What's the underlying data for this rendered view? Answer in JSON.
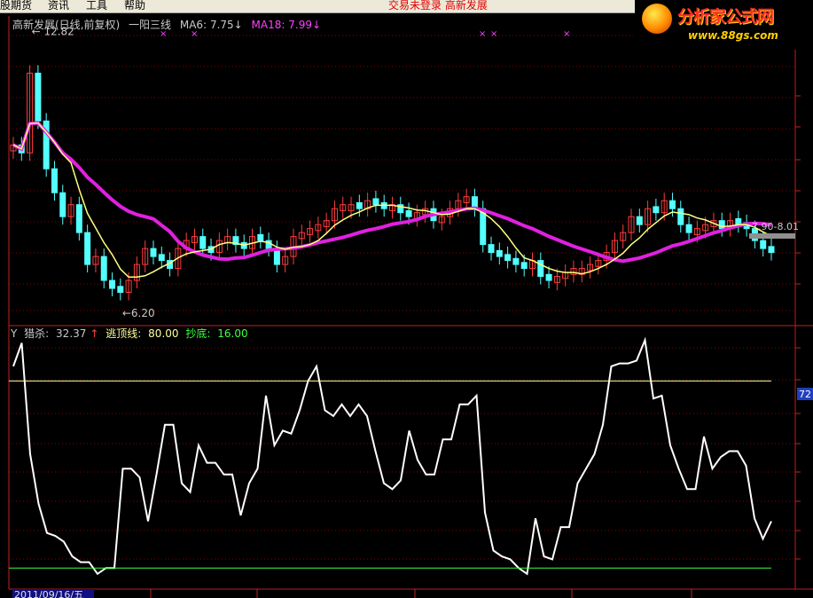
{
  "menu": {
    "items": [
      "股期货",
      "资讯",
      "工具",
      "帮助"
    ],
    "status_notice": "交易未登录  高新发展"
  },
  "logo": {
    "title": "分析家公式网",
    "url": "www.88gs.com"
  },
  "main_panel": {
    "title": "高新发展(日线,前复权)",
    "indicator_name": "一阳三线",
    "ma6_label": "MA6:",
    "ma6_value": "7.75",
    "ma18_label": "MA18:",
    "ma18_value": "7.99",
    "high_marker": "12.82",
    "low_marker": "6.20",
    "price_tag": "7.90-8.01",
    "colors": {
      "up": "#ff3c3c",
      "down": "#54ffff",
      "ma6": "#ffff80",
      "ma18": "#e020e0",
      "grid": "#8b0000"
    }
  },
  "indicator_panel": {
    "y_label": "Y",
    "hunt_label": "猎杀:",
    "hunt_value": "32.37",
    "top_label": "逃顶线:",
    "top_value": "80.00",
    "bottom_label": "抄底:",
    "bottom_value": "16.00",
    "right_tag": "72"
  },
  "date_label": "2011/09/16/五",
  "chart_data": [
    {
      "type": "candlestick",
      "series": [
        {
          "name": "MA6",
          "value": 7.75
        },
        {
          "name": "MA18",
          "value": 7.99
        }
      ],
      "annotations": [
        {
          "text": "12.82",
          "type": "high"
        },
        {
          "text": "6.20",
          "type": "low"
        }
      ],
      "candles_close": [
        10.2,
        10.0,
        12.0,
        10.8,
        9.6,
        9.0,
        8.4,
        8.7,
        8.0,
        7.2,
        7.4,
        6.8,
        6.6,
        6.5,
        6.8,
        7.2,
        7.6,
        7.4,
        7.3,
        7.1,
        7.6,
        7.8,
        7.9,
        7.6,
        7.5,
        7.8,
        7.9,
        7.7,
        7.6,
        7.9,
        7.8,
        7.6,
        7.2,
        7.4,
        7.9,
        8.0,
        8.1,
        8.2,
        8.3,
        8.6,
        8.7,
        8.7,
        8.6,
        8.8,
        8.7,
        8.6,
        8.7,
        8.5,
        8.4,
        8.5,
        8.6,
        8.3,
        8.4,
        8.6,
        8.8,
        8.9,
        8.6,
        7.7,
        7.5,
        7.4,
        7.3,
        7.2,
        7.1,
        7.3,
        6.9,
        6.8,
        6.9,
        7.0,
        7.1,
        7.1,
        7.2,
        7.3,
        7.5,
        7.8,
        8.0,
        8.4,
        8.2,
        8.6,
        8.5,
        8.8,
        8.6,
        8.2,
        8.0,
        8.1,
        8.2,
        8.3,
        8.1,
        8.3,
        8.2,
        8.1,
        7.8,
        7.6,
        7.5
      ]
    },
    {
      "type": "line",
      "series": [
        {
          "name": "猎杀",
          "values": [
            85,
            93,
            55,
            38,
            28,
            27,
            25,
            20,
            18,
            18,
            14,
            16,
            16,
            50,
            50,
            47,
            32,
            48,
            65,
            65,
            45,
            42,
            58,
            52,
            52,
            48,
            48,
            34,
            45,
            50,
            75,
            58,
            63,
            62,
            70,
            80,
            85,
            70,
            68,
            72,
            68,
            72,
            68,
            56,
            45,
            43,
            46,
            63,
            53,
            48,
            48,
            60,
            60,
            72,
            72,
            75,
            35,
            22,
            20,
            19,
            16,
            14,
            33,
            20,
            19,
            30,
            30,
            45,
            50,
            55,
            65,
            85,
            86,
            86,
            87,
            94,
            74,
            75,
            58,
            50,
            43,
            43,
            61,
            50,
            54,
            56,
            56,
            51,
            33,
            26,
            32
          ]
        }
      ],
      "hlines": [
        {
          "label": "逃顶线",
          "value": 80
        },
        {
          "label": "抄底",
          "value": 16
        }
      ],
      "ylim": [
        10,
        95
      ]
    }
  ]
}
